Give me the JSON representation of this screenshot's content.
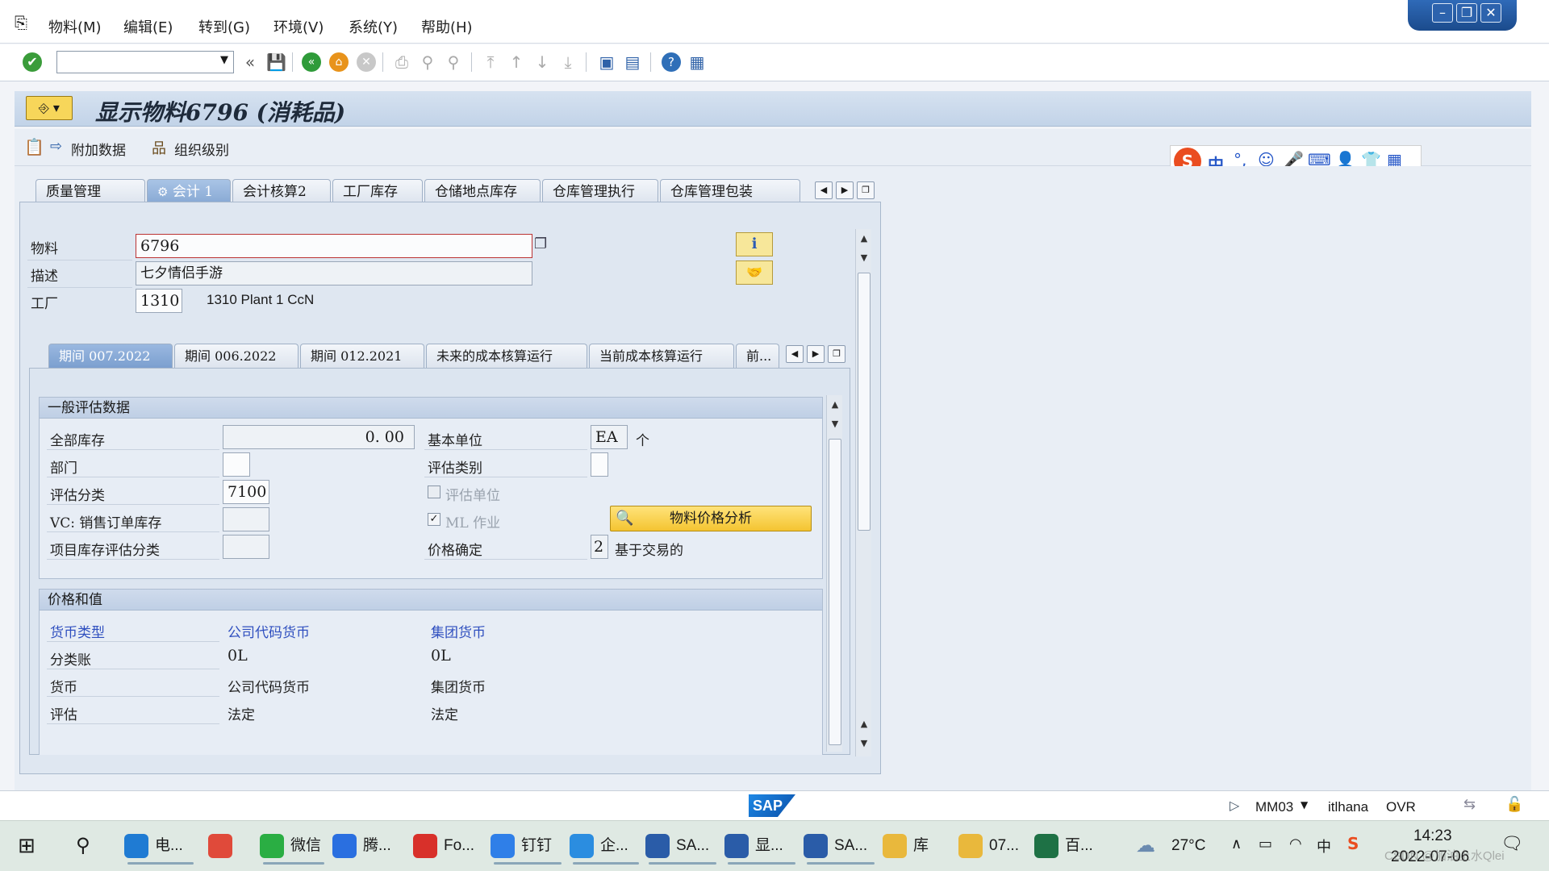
{
  "menu": {
    "items": [
      "物料(M)",
      "编辑(E)",
      "转到(G)",
      "环境(V)",
      "系统(Y)",
      "帮助(H)"
    ]
  },
  "title": {
    "text": "显示物料6796 (消耗品)"
  },
  "app_toolbar": {
    "additional_data": "附加数据",
    "org_levels": "组织级别"
  },
  "tabs": [
    "质量管理",
    "会计 1",
    "会计核算2",
    "工厂库存",
    "仓储地点库存",
    "仓库管理执行",
    "仓库管理包装"
  ],
  "header": {
    "material_label": "物料",
    "material_value": "6796",
    "desc_label": "描述",
    "desc_value": "七夕情侣手游",
    "plant_label": "工厂",
    "plant_value": "1310",
    "plant_text": "1310 Plant 1 CcN"
  },
  "period_tabs": [
    "期间 007.2022",
    "期间 006.2022",
    "期间 012.2021",
    "未来的成本核算运行",
    "当前成本核算运行",
    "前..."
  ],
  "general_valuation": {
    "title": "一般评估数据",
    "total_stock_label": "全部库存",
    "total_stock_value": "0. 00",
    "division_label": "部门",
    "valuation_class_label": "评估分类",
    "valuation_class_value": "7100",
    "vc_label": "VC: 销售订单库存",
    "proj_label": "项目库存评估分类",
    "base_unit_label": "基本单位",
    "base_unit_value": "EA",
    "base_unit_text": "个",
    "valuation_cat_label": "评估类别",
    "valuation_unit_label": "评估单位",
    "ml_label": "ML 作业",
    "price_det_label": "价格确定",
    "price_det_value": "2",
    "price_det_text": "基于交易的",
    "price_analysis_button": "物料价格分析"
  },
  "prices": {
    "title": "价格和值",
    "col_currency_type": "货币类型",
    "col_company_currency": "公司代码货币",
    "col_group_currency": "集团货币",
    "rows": [
      {
        "label": "分类账",
        "c1": "0L",
        "c2": "0L"
      },
      {
        "label": "货币",
        "c1": "公司代码货币",
        "c2": "集团货币"
      },
      {
        "label": "评估",
        "c1": "法定",
        "c2": "法定"
      }
    ]
  },
  "status": {
    "tcode": "MM03",
    "system": "itlhana",
    "mode": "OVR",
    "sap_logo": "SAP"
  },
  "taskbar": {
    "apps": [
      {
        "label": "电...",
        "icon": "edge-icon",
        "color": "#1f7bd3"
      },
      {
        "label": "",
        "icon": "chrome-icon",
        "color": "#e04a3a"
      },
      {
        "label": "微信",
        "icon": "wechat-icon",
        "color": "#2aae43"
      },
      {
        "label": "腾...",
        "icon": "tencent-meeting-icon",
        "color": "#2a6fe0"
      },
      {
        "label": "Fo...",
        "icon": "foxit-icon",
        "color": "#d8302a"
      },
      {
        "label": "钉钉",
        "icon": "dingtalk-icon",
        "color": "#2f7fe8"
      },
      {
        "label": "企...",
        "icon": "wecom-icon",
        "color": "#2b8de0"
      },
      {
        "label": "SA...",
        "icon": "sap-logon-icon",
        "color": "#2a5ca8"
      },
      {
        "label": "显...",
        "icon": "sap-gui-icon",
        "color": "#2a5ca8"
      },
      {
        "label": "SA...",
        "icon": "sap-gui-icon",
        "color": "#2a5ca8"
      },
      {
        "label": "库",
        "icon": "folder-icon",
        "color": "#e9b83c"
      },
      {
        "label": "07...",
        "icon": "folder-icon",
        "color": "#e9b83c"
      },
      {
        "label": "百...",
        "icon": "excel-icon",
        "color": "#1e7145"
      }
    ],
    "weather": "27°C",
    "time": "14:23",
    "date": "2022-07-06",
    "watermark": "CSDN @加油上水Qlei"
  },
  "ime": {
    "lang": "中"
  }
}
